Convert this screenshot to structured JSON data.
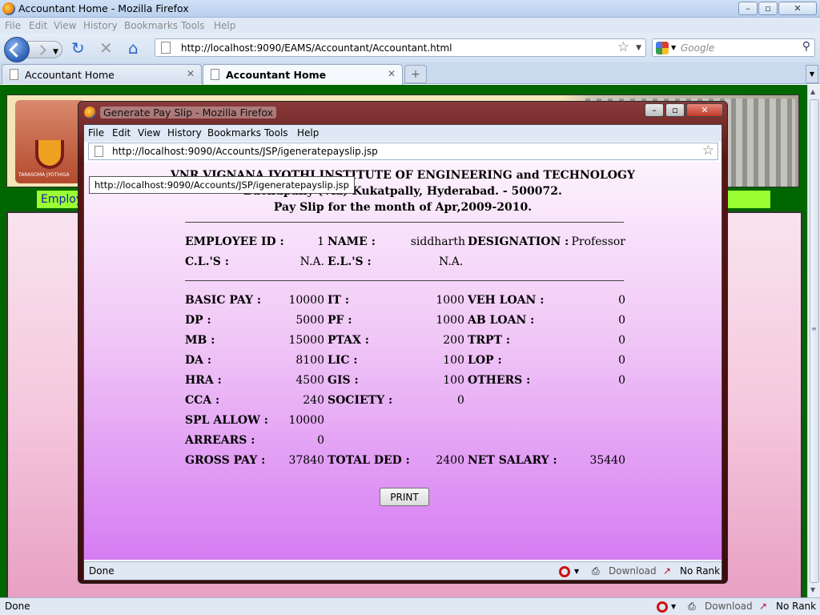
{
  "window": {
    "title": "Accountant Home - Mozilla Firefox",
    "menu": [
      "File",
      "Edit",
      "View",
      "History",
      "Bookmarks",
      "Tools",
      "Help"
    ],
    "url": "http://localhost:9090/EAMS/Accountant/Accountant.html",
    "search_placeholder": "Google",
    "tabs": [
      {
        "label": "Accountant Home",
        "active": false
      },
      {
        "label": "Accountant Home",
        "active": true
      }
    ],
    "status": "Done",
    "status_items": {
      "download": "Download",
      "rank": "No Rank"
    }
  },
  "background_page": {
    "nav_label": "Employ",
    "logo_text": "TARASOMA JYOTHIGA"
  },
  "popup": {
    "title": "Generate Pay Slip - Mozilla Firefox",
    "menu": [
      "File",
      "Edit",
      "View",
      "History",
      "Bookmarks",
      "Tools",
      "Help"
    ],
    "url": "http://localhost:9090/Accounts/JSP/igeneratepayslip.jsp",
    "tooltip": "http://localhost:9090/Accounts/JSP/igeneratepayslip.jsp",
    "status": "Done",
    "status_items": {
      "download": "Download",
      "rank": "No Rank"
    }
  },
  "payslip": {
    "institute": "VNR VIGNANA JYOTHI INSTITUTE OF ENGINEERING and TECHNOLOGY",
    "address": "Bachupally (Via) Kukatpally, Hyderabad. - 500072.",
    "period": "Pay Slip for the month of Apr,2009-2010.",
    "employee": {
      "id_label": "EMPLOYEE ID :",
      "id": "1",
      "name_label": "NAME :",
      "name": "siddharth",
      "designation_label": "DESIGNATION :",
      "designation": "Professor",
      "cl_label": "C.L.'S :",
      "cl": "N.A.",
      "el_label": "E.L.'S :",
      "el": "N.A."
    },
    "earnings": [
      {
        "label": "BASIC PAY :",
        "value": "10000"
      },
      {
        "label": "DP :",
        "value": "5000"
      },
      {
        "label": "MB :",
        "value": "15000"
      },
      {
        "label": "DA :",
        "value": "8100"
      },
      {
        "label": "HRA :",
        "value": "4500"
      },
      {
        "label": "CCA :",
        "value": "240"
      },
      {
        "label": "SPL ALLOW :",
        "value": "10000"
      },
      {
        "label": "ARREARS :",
        "value": "0"
      }
    ],
    "deductions": [
      {
        "label": "IT :",
        "value": "1000"
      },
      {
        "label": "PF :",
        "value": "1000"
      },
      {
        "label": "PTAX :",
        "value": "200"
      },
      {
        "label": "LIC :",
        "value": "100"
      },
      {
        "label": "GIS :",
        "value": "100"
      },
      {
        "label": "SOCIETY :",
        "value": "0"
      }
    ],
    "other": [
      {
        "label": "VEH LOAN :",
        "value": "0"
      },
      {
        "label": "AB LOAN :",
        "value": "0"
      },
      {
        "label": "TRPT :",
        "value": "0"
      },
      {
        "label": "LOP :",
        "value": "0"
      },
      {
        "label": "OTHERS :",
        "value": "0"
      }
    ],
    "totals": {
      "gross_label": "GROSS PAY :",
      "gross": "37840",
      "ded_label": "TOTAL DED :",
      "ded": "2400",
      "net_label": "NET SALARY :",
      "net": "35440"
    },
    "print_label": "PRINT"
  }
}
